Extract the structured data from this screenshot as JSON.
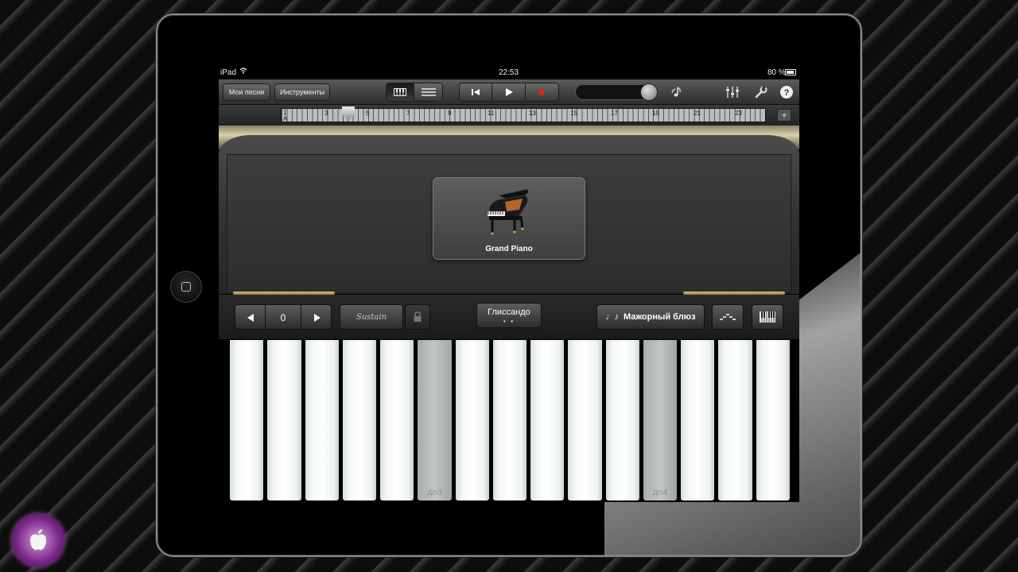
{
  "status_bar": {
    "device": "iPad",
    "time": "22:53",
    "battery": "80 %"
  },
  "toolbar": {
    "my_songs": "Мои песни",
    "instruments": "Инструменты",
    "view_keyboard_icon": "keyboard-view-icon",
    "view_tracks_icon": "tracks-view-icon",
    "rewind_icon": "rewind-icon",
    "play_icon": "play-icon",
    "record_icon": "record-icon",
    "record_color": "#e2231a"
  },
  "ruler": {
    "start_label": "A",
    "bars": [
      "1",
      "3",
      "5",
      "7",
      "9",
      "11",
      "13",
      "15",
      "17",
      "19",
      "21",
      "23"
    ],
    "add_label": "+"
  },
  "instrument": {
    "name": "Grand Piano"
  },
  "controls": {
    "octave_value": "0",
    "sustain_label": "Sustain",
    "glissando_label": "Глиссандо",
    "glissando_dots": "● ●",
    "scale_label": "Мажорный блюз",
    "scale_icon": "♩♪"
  },
  "keys": [
    {
      "label": "",
      "dim": false
    },
    {
      "label": "",
      "dim": false
    },
    {
      "label": "",
      "dim": false
    },
    {
      "label": "",
      "dim": false
    },
    {
      "label": "",
      "dim": false
    },
    {
      "label": "до3",
      "dim": true
    },
    {
      "label": "",
      "dim": false
    },
    {
      "label": "",
      "dim": false
    },
    {
      "label": "",
      "dim": false
    },
    {
      "label": "",
      "dim": false
    },
    {
      "label": "",
      "dim": false
    },
    {
      "label": "до4",
      "dim": true
    },
    {
      "label": "",
      "dim": false
    },
    {
      "label": "",
      "dim": false
    },
    {
      "label": "",
      "dim": false
    }
  ]
}
